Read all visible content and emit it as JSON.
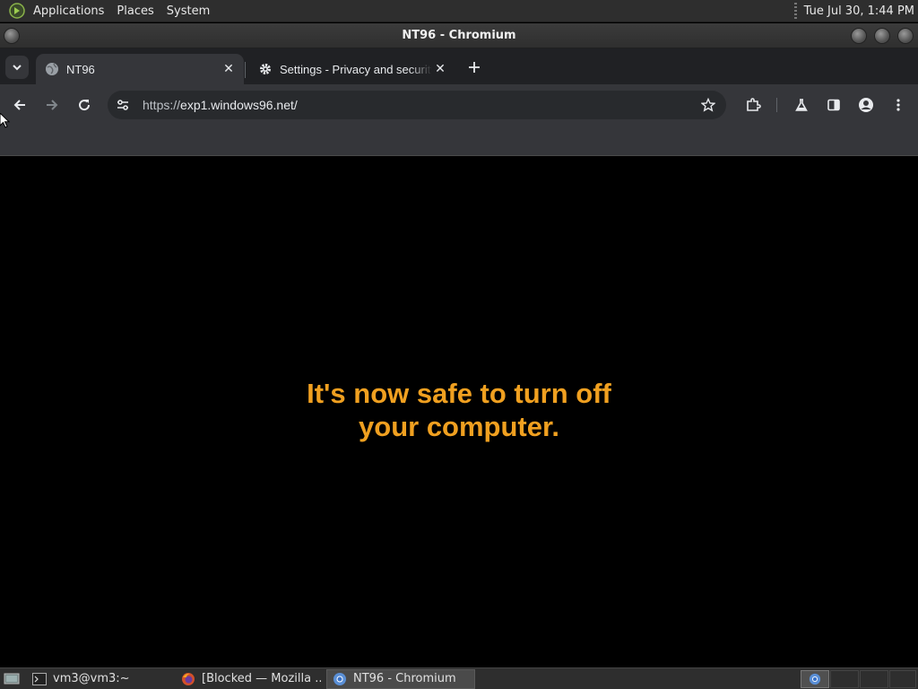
{
  "top_panel": {
    "menus": [
      "Applications",
      "Places",
      "System"
    ],
    "clock": "Tue Jul 30,  1:44 PM"
  },
  "window": {
    "title": "NT96 - Chromium"
  },
  "tabs": [
    {
      "label": "NT96",
      "icon": "globe-icon",
      "active": true
    },
    {
      "label": "Settings - Privacy and security",
      "icon": "gear-icon",
      "active": false
    }
  ],
  "toolbar": {
    "url_scheme": "https://",
    "url_host": "exp1.windows96.net/"
  },
  "content": {
    "line1": "It's now safe to turn off",
    "line2": "your computer.",
    "text_color": "#f0a020"
  },
  "taskbar": {
    "tasks": [
      {
        "label": "vm3@vm3:~",
        "icon": "terminal-icon",
        "active": false
      },
      {
        "label": "[Blocked — Mozilla ...",
        "icon": "firefox-icon",
        "active": false
      },
      {
        "label": "NT96 - Chromium",
        "icon": "chromium-icon",
        "active": true
      }
    ]
  }
}
